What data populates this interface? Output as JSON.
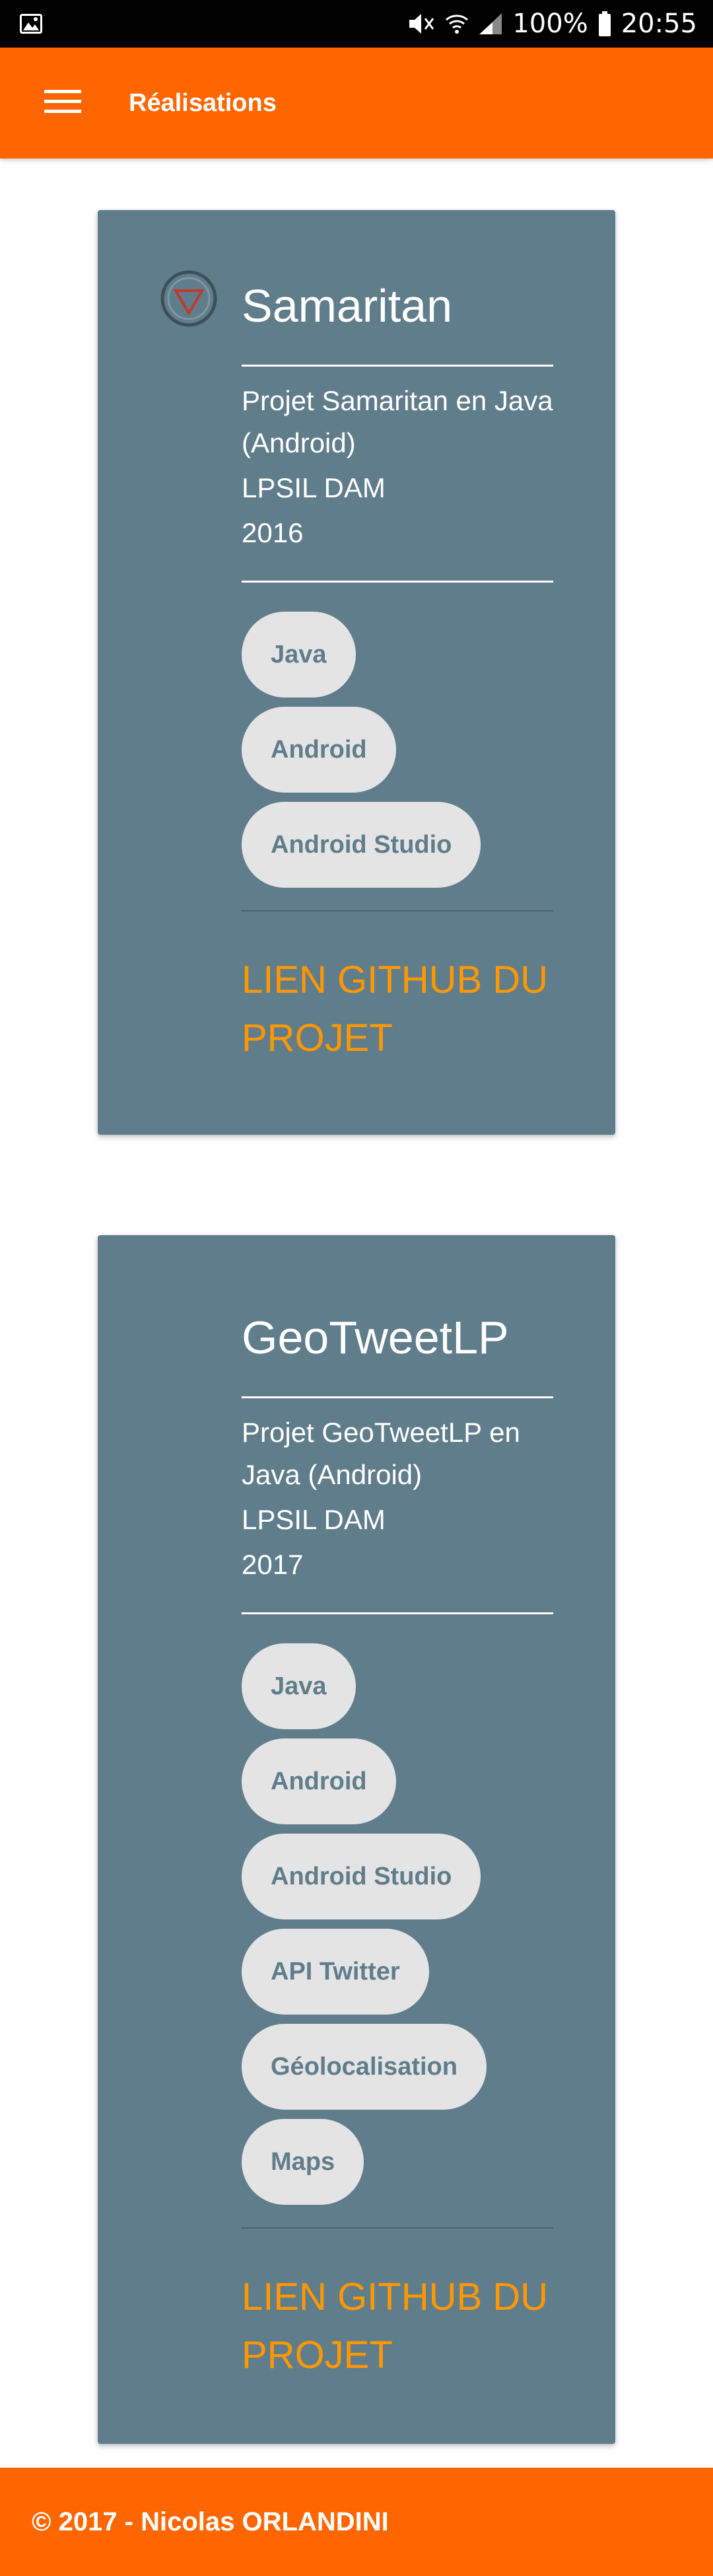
{
  "status_bar": {
    "battery": "100%",
    "time": "20:55",
    "icons": [
      "image-icon",
      "mute-icon",
      "wifi-icon",
      "signal-icon",
      "battery-icon"
    ]
  },
  "app_bar": {
    "title": "Réalisations",
    "menu_icon": "hamburger-menu-icon"
  },
  "projects": [
    {
      "title": "Samaritan",
      "description": "Projet Samaritan en Java (Android)",
      "program": "LPSIL DAM",
      "year": "2016",
      "tags": [
        "Java",
        "Android",
        "Android Studio"
      ],
      "link_label": "Lien GitHub du projet"
    },
    {
      "title": "GeoTweetLP",
      "description": "Projet GeoTweetLP en Java (Android)",
      "program": "LPSIL DAM",
      "year": "2017",
      "tags": [
        "Java",
        "Android",
        "Android Studio",
        "API Twitter",
        "Géolocalisation",
        "Maps"
      ],
      "link_label": "Lien GitHub du projet"
    }
  ],
  "footer": {
    "text": "© 2017 - Nicolas ORLANDINI"
  },
  "colors": {
    "primary": "#ff6600",
    "card": "#607d8b",
    "chip_bg": "#e4e4e4",
    "link": "#ff9800"
  }
}
